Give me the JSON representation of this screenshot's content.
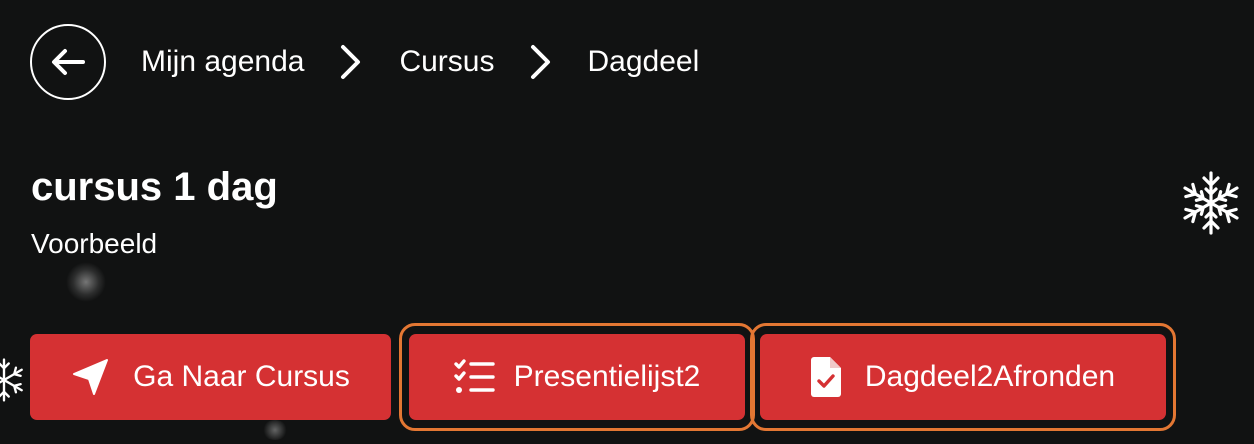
{
  "breadcrumb": {
    "back_icon": "arrow-left-icon",
    "items": [
      "Mijn agenda",
      "Cursus",
      "Dagdeel"
    ],
    "separator_icon": "chevron-right-icon"
  },
  "header": {
    "title": "cursus 1 dag",
    "subtitle": "Voorbeeld"
  },
  "actions": [
    {
      "label": "Ga Naar Cursus",
      "icon": "navigation-arrow-icon"
    },
    {
      "label": "Presentielijst2",
      "icon": "checklist-icon"
    },
    {
      "label": "Dagdeel2Afronden",
      "icon": "file-check-icon"
    }
  ],
  "decorations": {
    "snowflake_icon": "snowflake-icon"
  },
  "colors": {
    "background": "#111212",
    "button": "#d53133",
    "focus_ring": "#e37733",
    "text": "#ffffff"
  }
}
